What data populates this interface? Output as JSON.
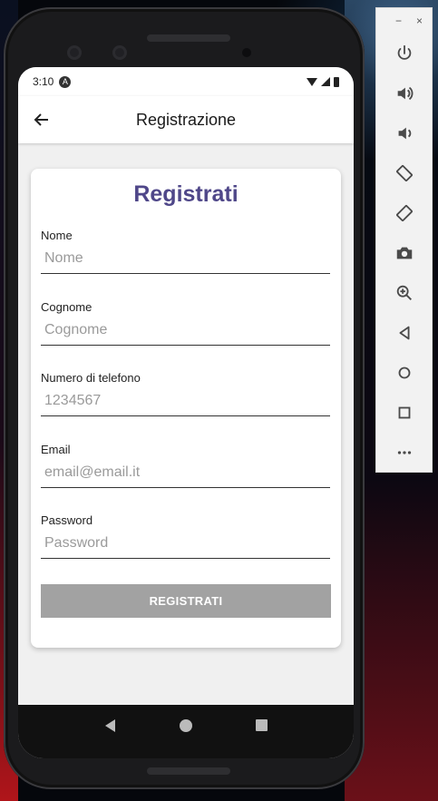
{
  "status_bar": {
    "time": "3:10",
    "notification_icon": "A"
  },
  "app_bar": {
    "back_icon": "arrow-left-icon",
    "title": "Registrazione"
  },
  "form": {
    "heading": "Registrati",
    "fields": [
      {
        "label": "Nome",
        "placeholder": "Nome",
        "value": ""
      },
      {
        "label": "Cognome",
        "placeholder": "Cognome",
        "value": ""
      },
      {
        "label": "Numero di telefono",
        "placeholder": "1234567",
        "value": ""
      },
      {
        "label": "Email",
        "placeholder": "email@email.it",
        "value": ""
      },
      {
        "label": "Password",
        "placeholder": "Password",
        "value": ""
      }
    ],
    "submit_label": "REGISTRATI"
  },
  "emulator_toolbar": {
    "minimize": "−",
    "close": "×",
    "buttons": [
      "power-icon",
      "volume-up-icon",
      "volume-down-icon",
      "rotate-left-icon",
      "rotate-right-icon",
      "camera-icon",
      "zoom-icon",
      "back-icon",
      "home-icon",
      "overview-icon",
      "more-icon"
    ]
  },
  "colors": {
    "heading": "#4f4789",
    "button": "#a2a2a2",
    "screen_bg": "#f0f0f0"
  }
}
